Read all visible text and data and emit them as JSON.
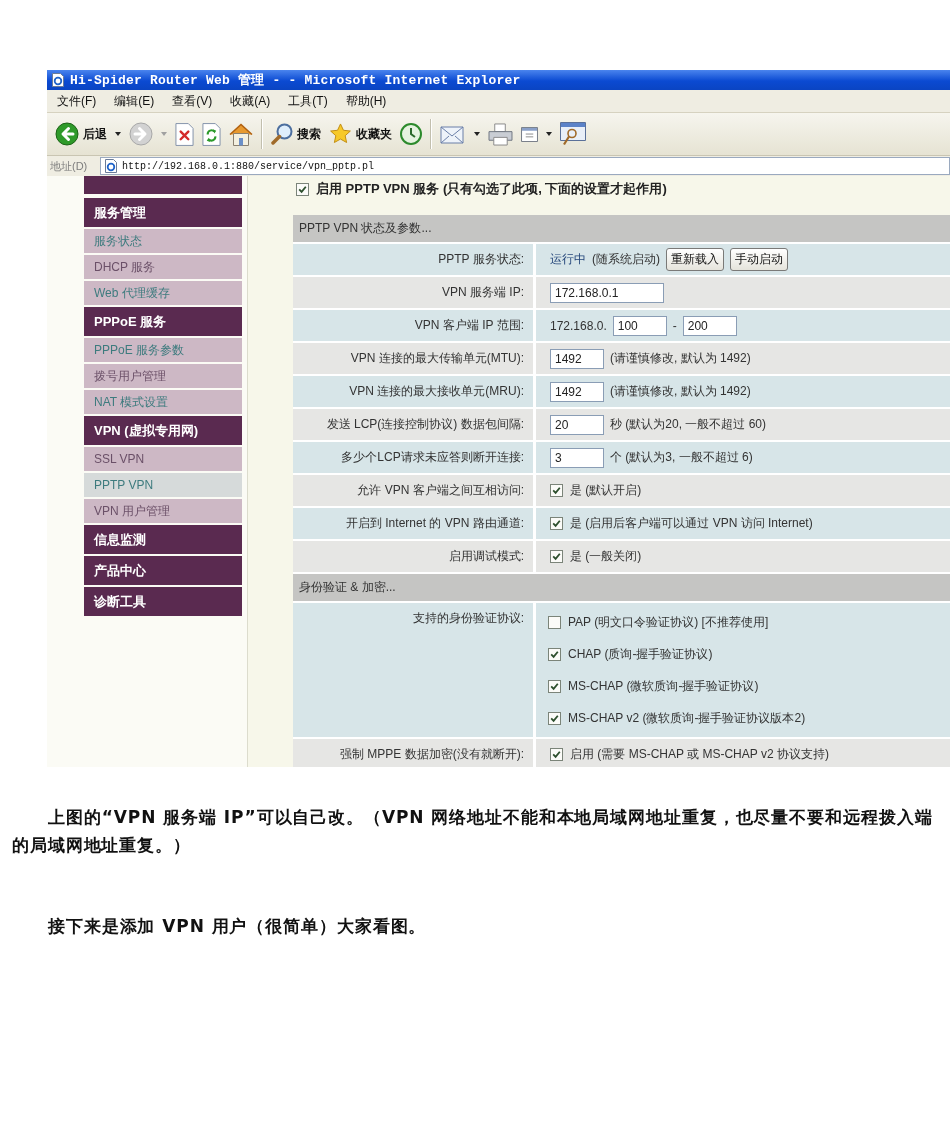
{
  "window": {
    "title": "Hi-Spider Router Web 管理 - - Microsoft Internet Explorer"
  },
  "menu_bar": [
    "文件(F)",
    "编辑(E)",
    "查看(V)",
    "收藏(A)",
    "工具(T)",
    "帮助(H)"
  ],
  "toolbar": [
    {
      "kind": "back",
      "label": "后退",
      "dropdown": true
    },
    {
      "kind": "forward",
      "dropdown": true
    },
    {
      "kind": "stop"
    },
    {
      "kind": "refresh"
    },
    {
      "kind": "home"
    },
    {
      "kind": "separator"
    },
    {
      "kind": "search",
      "label": "搜索"
    },
    {
      "kind": "favorites",
      "label": "收藏夹"
    },
    {
      "kind": "history"
    },
    {
      "kind": "separator"
    },
    {
      "kind": "mail",
      "dropdown": true
    },
    {
      "kind": "print"
    },
    {
      "kind": "edit",
      "dropdown": true
    },
    {
      "kind": "discuss"
    }
  ],
  "address_bar": {
    "label": "地址(D)",
    "url": "http://192.168.0.1:880/service/vpn_pptp.pl"
  },
  "sidebar": {
    "items": [
      {
        "kind": "clipped_header"
      },
      {
        "kind": "header",
        "label": "服务管理"
      },
      {
        "kind": "link",
        "label": "服务状态",
        "selected": false,
        "visited": false
      },
      {
        "kind": "link",
        "label": "DHCP 服务",
        "selected": false,
        "visited": true
      },
      {
        "kind": "link",
        "label": "Web 代理缓存",
        "selected": false,
        "visited": false
      },
      {
        "kind": "header",
        "label": "PPPoE 服务"
      },
      {
        "kind": "link",
        "label": "PPPoE 服务参数",
        "selected": false,
        "visited": false
      },
      {
        "kind": "link",
        "label": "拨号用户管理",
        "selected": false,
        "visited": true
      },
      {
        "kind": "link",
        "label": "NAT 模式设置",
        "selected": false,
        "visited": false
      },
      {
        "kind": "header",
        "label": "VPN (虚拟专用网)"
      },
      {
        "kind": "link",
        "label": "SSL VPN",
        "selected": false,
        "visited": true
      },
      {
        "kind": "link",
        "label": "PPTP VPN",
        "selected": true,
        "visited": false
      },
      {
        "kind": "link",
        "label": "VPN 用户管理",
        "selected": false,
        "visited": true
      },
      {
        "kind": "header",
        "label": "信息监测"
      },
      {
        "kind": "header",
        "label": "产品中心"
      },
      {
        "kind": "header",
        "label": "诊断工具"
      }
    ]
  },
  "enable_service": {
    "checked": true,
    "label": "启用 PPTP VPN 服务 (只有勾选了此项, 下面的设置才起作用)"
  },
  "sections": [
    {
      "title": "PPTP VPN 状态及参数...",
      "rows": [
        {
          "kind": "field",
          "label": "PPTP 服务状态:",
          "controls": [
            {
              "kind": "status",
              "text": "运行中"
            },
            {
              "kind": "text",
              "text": "(随系统启动)"
            },
            {
              "kind": "button",
              "label": "重新载入"
            },
            {
              "kind": "button",
              "label": "手动启动"
            }
          ]
        },
        {
          "kind": "field",
          "label": "VPN 服务端 IP:",
          "controls": [
            {
              "kind": "ip_input",
              "value": "172.168.0.1"
            }
          ]
        },
        {
          "kind": "field",
          "label": "VPN 客户端 IP 范围:",
          "controls": [
            {
              "kind": "text",
              "text": "172.168.0."
            },
            {
              "kind": "number_input",
              "value": "100"
            },
            {
              "kind": "text",
              "text": "-"
            },
            {
              "kind": "number_input",
              "value": "200"
            }
          ]
        },
        {
          "kind": "field",
          "label": "VPN 连接的最大传输单元(MTU):",
          "controls": [
            {
              "kind": "number_input",
              "value": "1492"
            },
            {
              "kind": "text",
              "text": "(请谨慎修改, 默认为 1492)"
            }
          ]
        },
        {
          "kind": "field",
          "label": "VPN 连接的最大接收单元(MRU):",
          "controls": [
            {
              "kind": "number_input",
              "value": "1492"
            },
            {
              "kind": "text",
              "text": "(请谨慎修改, 默认为 1492)"
            }
          ]
        },
        {
          "kind": "field",
          "label": "发送 LCP(连接控制协议) 数据包间隔:",
          "controls": [
            {
              "kind": "number_input",
              "value": "20"
            },
            {
              "kind": "text",
              "text": "秒 (默认为20, 一般不超过 60)"
            }
          ]
        },
        {
          "kind": "field",
          "label": "多少个LCP请求未应答则断开连接:",
          "controls": [
            {
              "kind": "number_input",
              "value": "3"
            },
            {
              "kind": "text",
              "text": "个 (默认为3, 一般不超过 6)"
            }
          ]
        },
        {
          "kind": "field",
          "label": "允许 VPN 客户端之间互相访问:",
          "controls": [
            {
              "kind": "checkbox",
              "checked": true,
              "label": "是 (默认开启)"
            }
          ]
        },
        {
          "kind": "field",
          "label": "开启到 Internet 的 VPN 路由通道:",
          "controls": [
            {
              "kind": "checkbox",
              "checked": true,
              "label": "是 (启用后客户端可以通过 VPN 访问 Internet)"
            }
          ]
        },
        {
          "kind": "field",
          "label": "启用调试模式:",
          "controls": [
            {
              "kind": "checkbox",
              "checked": true,
              "label": "是 (一般关闭)"
            }
          ]
        }
      ]
    },
    {
      "title": "身份验证 & 加密...",
      "rows": [
        {
          "kind": "checklist",
          "label": "支持的身份验证协议:",
          "controls": [
            {
              "kind": "checkbox",
              "checked": false,
              "label": "PAP (明文口令验证协议) [不推荐使用]"
            },
            {
              "kind": "checkbox",
              "checked": true,
              "label": "CHAP (质询-握手验证协议)"
            },
            {
              "kind": "checkbox",
              "checked": true,
              "label": "MS-CHAP (微软质询-握手验证协议)"
            },
            {
              "kind": "checkbox",
              "checked": true,
              "label": "MS-CHAP v2 (微软质询-握手验证协议版本2)"
            }
          ]
        },
        {
          "kind": "field",
          "label": "强制 MPPE 数据加密(没有就断开):",
          "controls": [
            {
              "kind": "checkbox",
              "checked": true,
              "label": "启用 (需要 MS-CHAP 或 MS-CHAP v2 协议支持)"
            }
          ]
        }
      ]
    }
  ],
  "article": {
    "paragraphs": [
      "上图的“VPN 服务端 IP”可以自己改。（VPN 网络地址不能和本地局域网地址重复，也尽量不要和远程拨入端的局域网地址重复。）",
      "接下来是添加 VPN 用户（很简单）大家看图。"
    ]
  }
}
